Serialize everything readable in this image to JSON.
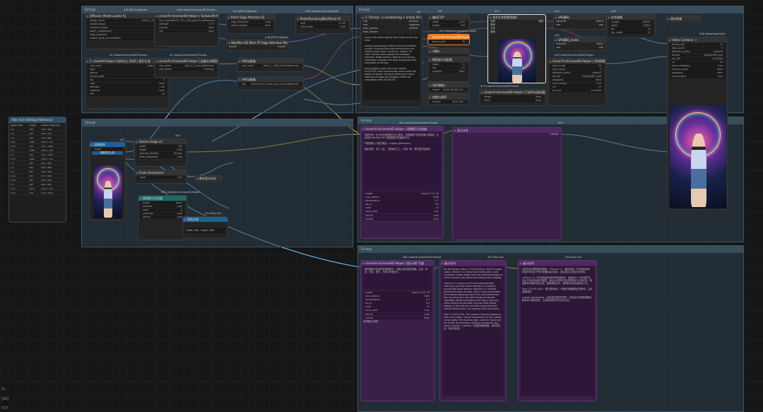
{
  "groups": [
    {
      "id": "g1",
      "title": "Group"
    },
    {
      "id": "g2",
      "title": "Group"
    },
    {
      "id": "g3",
      "title": "Group"
    },
    {
      "id": "g4",
      "title": "Group"
    },
    {
      "id": "g5",
      "title": "Group"
    }
  ],
  "size_ref": {
    "title": "Wan Size Settings Reference",
    "header": [
      "aspect ratio",
      "output",
      "output height (W)"
    ],
    "rows": [
      [
        "1:1",
        "720",
        "720 x 720"
      ],
      [
        "4:3",
        "960",
        "960 x 720"
      ],
      [
        "3:4",
        "720",
        "720 x 960"
      ],
      [
        "16:9",
        "1280",
        "1280 x 720"
      ],
      [
        "9:16",
        "720",
        "720 x 1280"
      ],
      [
        "3:2",
        "1080",
        "1080 x 720"
      ],
      [
        "2:3",
        "720",
        "720 x 1080"
      ],
      [
        "21:9",
        "1680",
        "1680 x 720"
      ],
      [
        "1:1",
        "480",
        "480 x 480"
      ],
      [
        "4:3",
        "640",
        "640 x 480"
      ],
      [
        "3:4",
        "480",
        "480 x 640"
      ],
      [
        "16:9",
        "832",
        "832 x 480"
      ],
      [
        "9:16",
        "480",
        "480 x 832"
      ],
      [
        "1:1",
        "960",
        "960 x 960"
      ],
      [
        "16:9",
        "1024",
        "1024 x 576"
      ],
      [
        "9:16",
        "576",
        "576 x 1024"
      ]
    ]
  },
  "nodes": {
    "diff": {
      "badge": "#45 [BETA] KJNodes",
      "title": "Diffusion Model Loader KJ",
      "w": [
        [
          "model_name",
          "wan2.1_i2v_480p..."
        ],
        [
          "weight_dtype",
          "default"
        ],
        [
          "compute_dtype",
          "default"
        ],
        [
          "patch_cublaslinear",
          "false"
        ],
        [
          "sage_attention",
          "disabled"
        ],
        [
          "enable_fp16_accumulation",
          "false"
        ]
      ]
    },
    "lora": {
      "badge": "#46 closerAI-minimaxHD-Prompt...",
      "title": "closerAI minimaxHD Helper | TurboLoRA Prompt",
      "w": [
        [
          "lora_name",
          "Wan21_T2V_14B_lightx2v.safetensors"
        ],
        [
          "strength",
          "0.75"
        ],
        [
          "prompt",
          "none"
        ],
        [
          "clip",
          "none"
        ]
      ]
    },
    "sage": {
      "badge": "#47 [BETA] KJNodes",
      "title": "Patch Sage Attention KJ",
      "w": [
        [
          "sage_attention",
          "auto"
        ],
        [
          "allow_compile",
          "false"
        ]
      ]
    },
    "blockswap": {
      "badge": "#48 [BETA] KJNodes",
      "title": "WanMax HD Mem FP Sage Attention Patch",
      "w": [
        [
          "model",
          "model"
        ]
      ]
    },
    "ksampler": {
      "badge": "#49 closerAI-minimaxHD-KS",
      "title": "ModelSamplingWanMixed 41",
      "w": [
        [
          "shift",
          "12.00"
        ],
        [
          "shift_mode",
          "8.00"
        ]
      ]
    },
    "clipvis": {
      "badge": "#1 closerAI-minimaxHD-Prompt...",
      "title": "1. closerAI Helper ClipProj | 2026 | 提示生成",
      "w": [
        [
          "clip_name",
          "open-clip-vit-h"
        ],
        [
          "type",
          "wan"
        ],
        [
          "device",
          "default"
        ],
        [
          "visual_mode",
          "RGB"
        ],
        [
          "cfg",
          "3"
        ],
        [
          "crop",
          "none"
        ],
        [
          "strength",
          "1.00"
        ],
        [
          "negative",
          "none"
        ],
        [
          "FPS",
          "16"
        ]
      ]
    },
    "vae": {
      "badge": "#4 closerAI-minimaxHD-Prompt...",
      "title": "closerAI minimaxHD Helper | 加载文本模型",
      "w": [
        [
          "vae_name",
          "wan_2.1_vae.safetensors"
        ],
        [
          "vae_model",
          "minimax"
        ]
      ]
    },
    "vaeload": {
      "title": "VAE加载器",
      "w": [
        [
          "vae_name",
          "Wan2_1_VAE_bf16.safetensors"
        ]
      ]
    },
    "vaeload2": {
      "title": "VAE加载器",
      "w": [
        [
          "vae",
          "minimax_hd_audio_vae_fp16.safetensors"
        ]
      ]
    },
    "prompt2": {
      "badge": "#6",
      "title": "2. Prompt - n conditioning + empty AV latent",
      "ins": [
        "clip",
        "vae",
        "text_frames",
        "text_frames"
      ],
      "outs": [
        "positive",
        "negative",
        "LATENT"
      ],
      "text": "music that starts slightly then fades as the clip ends.\n\noverall_soundscape: Distant carnival ambient sounds including faint ride mechanisms and muted crowd noise. Loudness: Subject Y.'s clear Chinese voice speaks the dialogue naturally. Rate/cadence: Natural and natural-expression changes and plays throughout the remainder of the clip.\n\nend_straight_music: No music before 00:02:000; enter melancholic piano when Yan begins to speak. Continue piano and mixing naturally through the dialogue; finish out completely after 00:06.000."
    },
    "prompt3": {
      "badge": "#8",
      "title": "编码CLIP",
      "w": [
        [
          "width",
          "1024"
        ],
        [
          "height",
          "576"
        ]
      ]
    },
    "audio": {
      "badge": "#13 closerAI-minimaxHD-Audio",
      "title": "closerAI-minimaxHD-Audio",
      "w": [
        [
          "audio",
          "none"
        ],
        [
          "frame_rate",
          "30"
        ]
      ]
    },
    "nfr": {
      "title": "nf输入",
      "w": [
        [
          "value",
          "0"
        ]
      ]
    },
    "modelcfg": {
      "title": "模型提示词配置",
      "w": [
        [
          "steps",
          "12"
        ],
        [
          "cfg",
          "1.0"
        ],
        [
          "sampler",
          "Kkey"
        ],
        [
          "scheduler",
          "res_2s"
        ],
        [
          "denoise",
          "10"
        ],
        [
          "noise",
          "0"
        ],
        [
          "seed",
          "0"
        ]
      ]
    },
    "sampler": {
      "title": "采样器输入",
      "w": [
        [
          "image",
          "00:01:00.000 00..."
        ],
        [
          "seed",
          "22"
        ]
      ]
    },
    "sampler2": {
      "title": "帧数与帧率",
      "w": [
        [
          "frames",
          "00:01:00..."
        ],
        [
          "mask",
          "22"
        ]
      ]
    },
    "advcfg": {
      "badge": "#22 closerAI-minimaxHD-Prompt",
      "title": "closerAI minimaxHD Helper | ClipProj采样器处理",
      "w": [
        [
          "image",
          "none"
        ],
        [
          "mask",
          "none"
        ],
        [
          "image",
          "none"
        ]
      ]
    },
    "videocomb": {
      "badge": "#15",
      "title": "合并文本视频(智能)",
      "ins": [
        "音频",
        "视频",
        "文本",
        "图像"
      ],
      "outs": [
        "视频"
      ]
    },
    "vaedec1": {
      "badge": "#21",
      "title": "VAE解码",
      "w": [
        [
          "samples",
          "latent"
        ],
        [
          "vae",
          "vae"
        ]
      ]
    },
    "vaedec2": {
      "badge": "#22",
      "title": "VAE解码_Audio",
      "w": [
        [
          "samples",
          "latent"
        ],
        [
          "vae",
          "vae"
        ]
      ]
    },
    "helperv": {
      "badge": "#23 closerAI-minimaxHD-Prompt...",
      "title": "closerAI minimaxHD Helper | HD视频保存",
      "w": [
        [
          "frame_rate",
          "30"
        ],
        [
          "loop_count",
          "0"
        ],
        [
          "filename_prefix",
          "closerAI"
        ],
        [
          "format",
          "video/h264-mp4"
        ],
        [
          "pingpong",
          "false"
        ],
        [
          "save_output",
          "true"
        ],
        [
          "crf",
          "19"
        ],
        [
          "pix_fmt",
          "yuv420p"
        ]
      ]
    },
    "combine": {
      "badge": "#24",
      "title": "合并图像",
      "w": [
        [
          "images",
          "IMAGE"
        ],
        [
          "audio",
          "AUDIO"
        ],
        [
          "fps",
          "24"
        ],
        [
          "fps_mode",
          "24"
        ]
      ]
    },
    "saveimg": {
      "title": "保存视频",
      "w": []
    },
    "vhs": {
      "badge": "#40 VideoHelperSuite",
      "title": "Video Combine 🎥",
      "w": [
        [
          "frame_rate",
          "24"
        ],
        [
          "loop_count",
          "0"
        ],
        [
          "filename_prefix",
          "closerAI"
        ],
        [
          "format",
          "video/h264-mp4"
        ],
        [
          "pix_fmt",
          "yuv420p"
        ],
        [
          "crf",
          "19"
        ],
        [
          "save_metadata",
          "true"
        ],
        [
          "trim_to_audio",
          "false"
        ],
        [
          "pingpong",
          "false"
        ],
        [
          "save_output",
          "true"
        ]
      ]
    },
    "loadimg": {
      "badge": "#11",
      "title": "加载图像",
      "w": [
        [
          "image",
          "comfyui_temp_png..."
        ]
      ],
      "btn": "选择文件上传"
    },
    "resize": {
      "badge": "#10",
      "title": "Resize Image v2",
      "w": [
        [
          "width",
          "720"
        ],
        [
          "height",
          "1280"
        ],
        [
          "upscale_method",
          "lanczos"
        ],
        [
          "keep_proportion",
          "crop"
        ],
        [
          "divisible_by",
          "16"
        ]
      ]
    },
    "getsize": {
      "badge": "#12",
      "title": "获取图像尺寸",
      "w": [
        [
          "width",
          "width"
        ],
        [
          "height",
          "height"
        ]
      ]
    },
    "floatnode": {
      "badge": "#13",
      "title": "Float (Animation)",
      "w": [
        [
          "value",
          "5.00"
        ]
      ]
    },
    "duration": {
      "badge": "#14",
      "title": "数字显示时长",
      "w": []
    },
    "qwen": {
      "badge": "#53 closerAI-minimaxHD-Prompt",
      "title": "视频提示生成器",
      "w": [
        [
          "model",
          "qwen"
        ],
        [
          "method",
          "auto"
        ],
        [
          "seed",
          "0"
        ],
        [
          "precision",
          "auto"
        ],
        [
          "device",
          "auto"
        ],
        [
          "size",
          "1024"
        ]
      ]
    },
    "qwen_hd": {
      "badge": "#14 Easy Use",
      "title": "预览任意",
      "w": []
    },
    "wh": {
      "title": "Width: 480 , height: 864",
      "w": []
    },
    "llm1": {
      "badge": "#51 closerAI-minimaxHD-Prompt",
      "title": "closerAI minimaxHD Helper | 视频提示生成器",
      "text": "你现在是一位专业的视频提示词工程师，请根据用户提供的图片和描述，生成适合 MiniMax HD 视频模型的详细提示词。\n\n严格按照以下格式输出：subject_definitions\n\n相机语言：向上飞近，飞跃城市之上，大城一角，摩天楼夕阳余辉。",
      "w": [
        [
          "model",
          "Qwen2.5-VL-7B"
        ],
        [
          "max_tokens",
          "2048"
        ],
        [
          "temperature",
          "0.7"
        ],
        [
          "top_p",
          "0.9"
        ],
        [
          "seed",
          "42"
        ],
        [
          "keep_alive",
          "true"
        ],
        [
          "device",
          "cuda"
        ],
        [
          "unload",
          "false"
        ]
      ]
    },
    "prevtxt": {
      "badge": "#52",
      "title": "显示文本",
      "outs": [
        "STRING"
      ]
    },
    "llm2": {
      "badge": "#61 closerAI-minimaxHD-Prompt",
      "title": "closerAI minimaxHD Helper | 提示词扩写器",
      "text": "预设模板中的结构化视频提示，请确认各项描述准确。主体、场景、动作、镜头、光影与声音设计。",
      "w": [
        [
          "model",
          "Qwen2.5-VL-7B"
        ],
        [
          "max_tokens",
          "2048"
        ],
        [
          "temperature",
          "0.7"
        ],
        [
          "top_p",
          "0.9"
        ],
        [
          "seed",
          "42"
        ],
        [
          "keep_alive",
          "true"
        ],
        [
          "device",
          "cuda"
        ],
        [
          "unload",
          "false"
        ]
      ],
      "extra": "参考图片说明"
    },
    "show1": {
      "badge": "#52 Easy Use",
      "title": "展示任何",
      "text": "For the target video, in 9:16 vertical, use the target video: <Picture 1> (fixed first frame) with a fully consistent single image from the real-life footage at a first frame or last frame according to the request.\n\n<Picture 1> serves as the character/identity reference and first frame reference. It shows a young East Asian woman standing in a vibrant amusement park at night, with a large illuminated Ferris wheel glowing in pink and cyan behind her. She has long dark hair with bangs and gentle highlights, wearing dangling earrings, a pink and white striped off-shoulder crop top with ruffled sleeves, a blue denim mini skirt decorated with colorful floral prints, and layered pearl necklaces.\n\nShot 1 (0:00-0:05): The camera remains stationary with very subtle, natural movement, as the subject smiles softly. The evening light, carnival music and the bright illuminations continue throughout the scene. Subject Y. speaks: \"这里的夜晚真美，我们再去坐一次摩天轮吧。\""
    },
    "show2": {
      "badge": "#53 Easy Use",
      "title": "展示任何",
      "text": "这是在游乐园拍摄的视频，<Picture 1>（固定首帧）作为角色参考。年轻的东亚女子站在夜晚的游乐园中，身后是巨大的发光摩天轮。\n\n<Picture 1> 作为角色身份参考和首帧参考。画面显示一位年轻的东亚女子站在夜间游乐园里，身后巨大的摩天轮闪烁粉色与青色的光。她留着带刘海的深色长发，戴着垂坠耳环，身穿粉白条纹露肩短上衣。\n\nShot 1 (0:00-0:05)：镜头保持静止，伴随非常细微的自然移动，主体温柔微笑。\n\noverall_soundscape：远处游乐园的环境声，包括游乐设施的微弱运转声和人群的低语。主体用清晰的中文说出对白。"
    }
  },
  "hud": [
    "0s",
    "[40]",
    "537"
  ]
}
